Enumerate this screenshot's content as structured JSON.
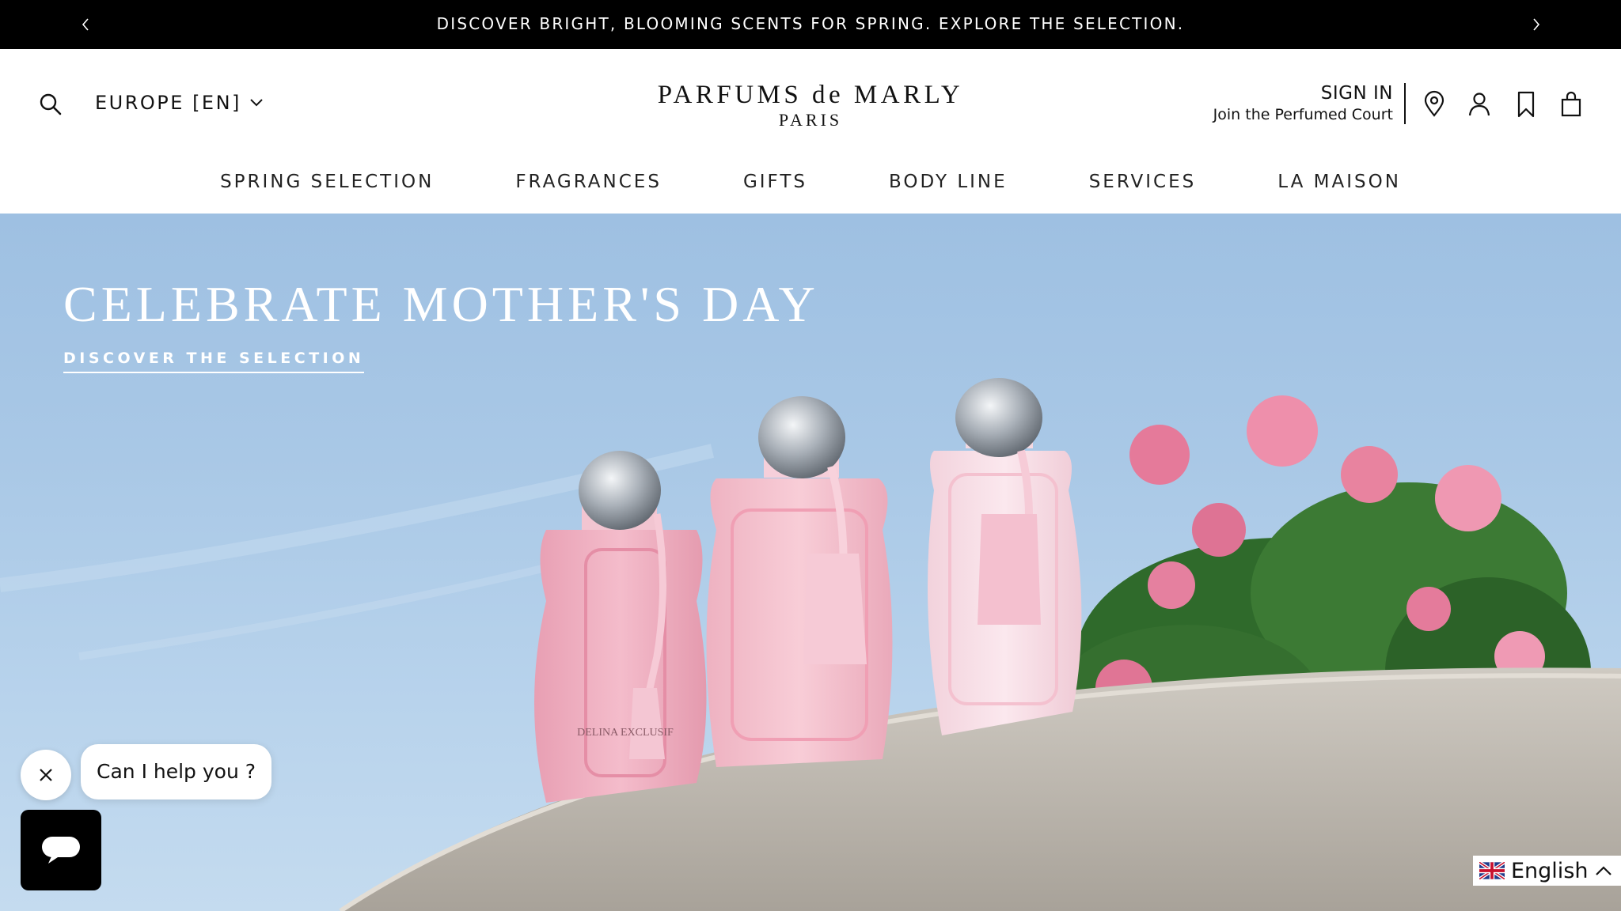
{
  "announcement": {
    "message": "DISCOVER BRIGHT, BLOOMING SCENTS FOR SPRING. EXPLORE THE SELECTION.",
    "prev_icon": "chevron-left-icon",
    "next_icon": "chevron-right-icon"
  },
  "header": {
    "region_label": "EUROPE [EN]",
    "logo_line1": "PARFUMS de MARLY",
    "logo_line2": "PARIS",
    "sign_in": "SIGN IN",
    "join_text": "Join the Perfumed Court",
    "icons": [
      "search-icon",
      "location-pin-icon",
      "account-icon",
      "bookmark-icon",
      "shopping-bag-icon"
    ]
  },
  "nav": {
    "items": [
      {
        "label": "SPRING SELECTION"
      },
      {
        "label": "FRAGRANCES"
      },
      {
        "label": "GIFTS"
      },
      {
        "label": "BODY LINE"
      },
      {
        "label": "SERVICES"
      },
      {
        "label": "LA MAISON"
      }
    ]
  },
  "hero": {
    "title": "CELEBRATE MOTHER'S DAY",
    "cta": "DISCOVER THE SELECTION",
    "bottle_label": "DELINA EXCLUSIF"
  },
  "chat": {
    "prompt": "Can I help you ?",
    "close_icon": "close-icon",
    "launcher_icon": "chat-icon"
  },
  "language": {
    "label": "English",
    "flag_icon": "uk-flag-icon",
    "chevron_icon": "chevron-up-icon"
  },
  "colors": {
    "announcement_bg": "#000000",
    "sky": "#a9c8e6",
    "bottle_pink": "#f2b6c6"
  }
}
